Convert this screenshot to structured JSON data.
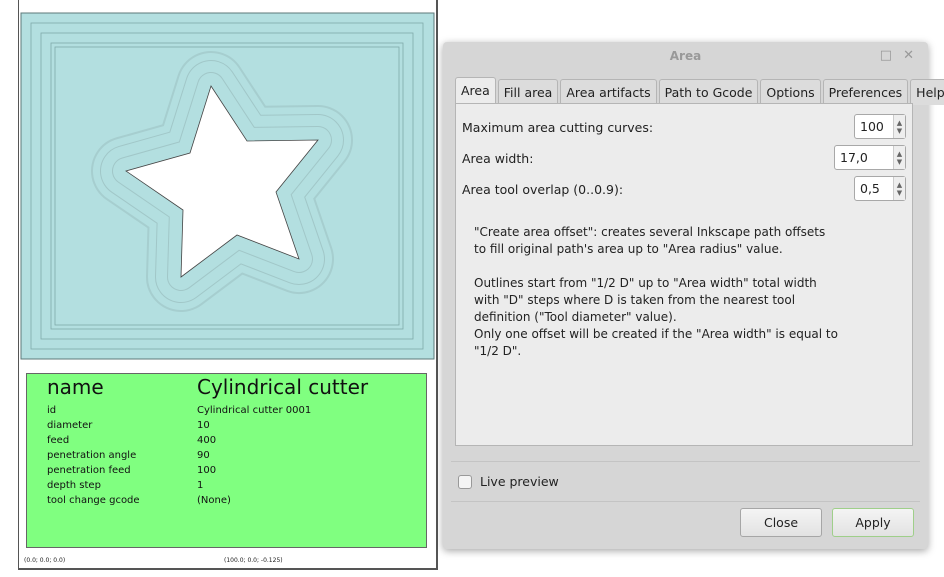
{
  "canvas": {
    "tool": {
      "name_label": "name",
      "name_value": "Cylindrical cutter",
      "rows": [
        [
          "id",
          "Cylindrical cutter 0001"
        ],
        [
          "diameter",
          "10"
        ],
        [
          "feed",
          "400"
        ],
        [
          "penetration angle",
          "90"
        ],
        [
          "penetration feed",
          "100"
        ],
        [
          "depth step",
          "1"
        ],
        [
          "tool change gcode",
          "(None)"
        ]
      ]
    },
    "coords": [
      "(0.0; 0.0; 0.0)",
      "(100.0; 0.0; -0.125)"
    ],
    "colors": {
      "area_fill": "#b3dfe0",
      "tool_fill": "#80ff80"
    }
  },
  "dialog": {
    "title": "Area",
    "tabs": [
      "Area",
      "Fill area",
      "Area artifacts",
      "Path to Gcode",
      "Options",
      "Preferences",
      "Help"
    ],
    "active_tab": "Area",
    "fields": [
      {
        "label": "Maximum area cutting curves:",
        "value": "100"
      },
      {
        "label": "Area width:",
        "value": "17,0"
      },
      {
        "label": "Area tool overlap (0..0.9):",
        "value": "0,5"
      }
    ],
    "help_text": "\"Create area offset\": creates several Inkscape path offsets\nto fill original path's area up to \"Area radius\" value.\n\nOutlines start from \"1/2 D\" up to \"Area width\" total width\nwith \"D\" steps where D is taken from the nearest tool\ndefinition (\"Tool diameter\" value).\nOnly one offset will be created if the \"Area width\" is equal to\n\"1/2 D\".",
    "live_preview_label": "Live preview",
    "live_preview_checked": false,
    "close_label": "Close",
    "apply_label": "Apply"
  }
}
